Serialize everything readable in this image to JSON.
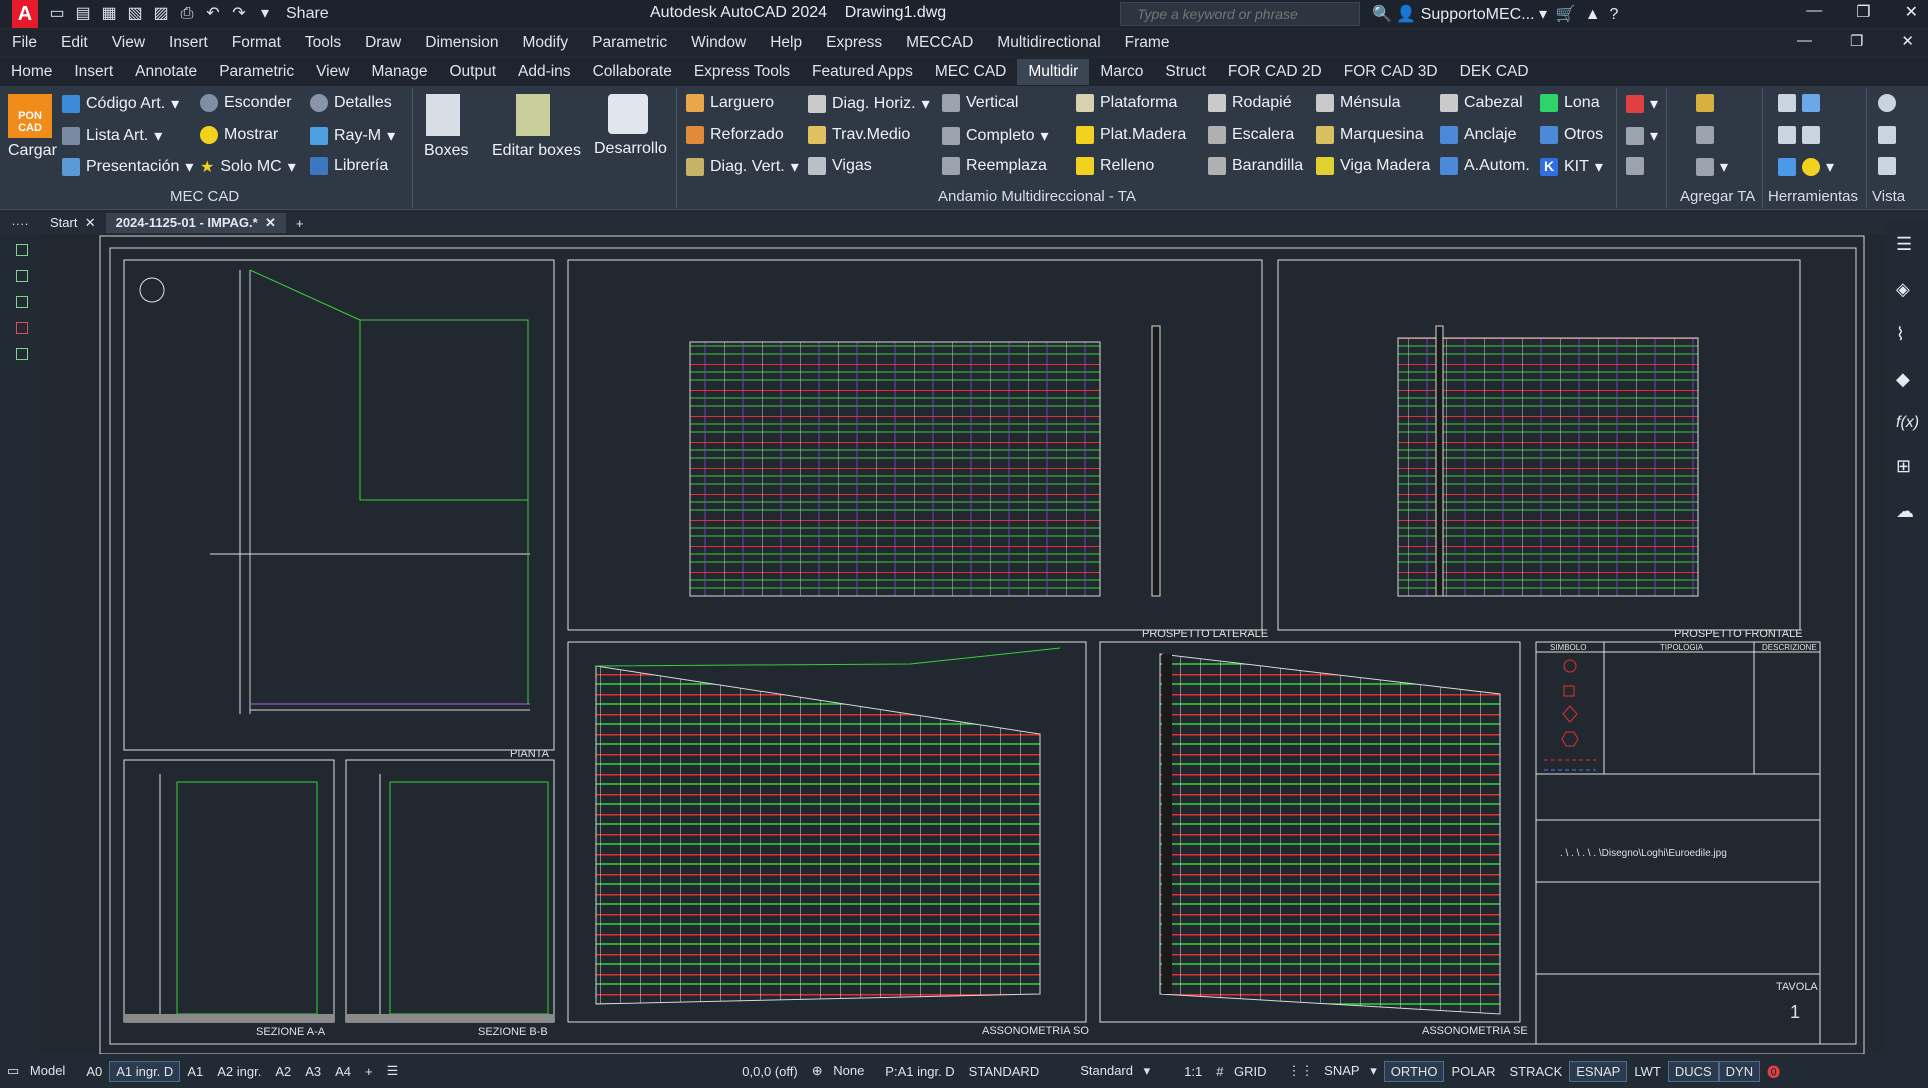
{
  "titlebar": {
    "app_title": "Autodesk AutoCAD 2024",
    "doc_title": "Drawing1.dwg",
    "share": "Share",
    "search_placeholder": "Type a keyword or phrase",
    "user": "SupportoMEC..."
  },
  "menu": [
    "File",
    "Edit",
    "View",
    "Insert",
    "Format",
    "Tools",
    "Draw",
    "Dimension",
    "Modify",
    "Parametric",
    "Window",
    "Help",
    "Express",
    "MECCAD",
    "Multidirectional",
    "Frame"
  ],
  "tabs": [
    "Home",
    "Insert",
    "Annotate",
    "Parametric",
    "View",
    "Manage",
    "Output",
    "Add-ins",
    "Collaborate",
    "Express Tools",
    "Featured Apps",
    "MEC CAD",
    "Multidir",
    "Marco",
    "Struct",
    "FOR CAD 2D",
    "FOR CAD 3D",
    "DEK CAD"
  ],
  "active_tab": "Multidir",
  "ribbon": {
    "mec": {
      "cargar": "Cargar",
      "codigo": "Código Art.",
      "lista": "Lista Art.",
      "presentacion": "Presentación",
      "esconder": "Esconder",
      "mostrar": "Mostrar",
      "solo": "Solo MC",
      "detalles": "Detalles",
      "raym": "Ray-M",
      "libreria": "Librería",
      "group": "MEC CAD",
      "logo": "PON CAD"
    },
    "boxes": {
      "boxes": "Boxes",
      "editar": "Editar boxes",
      "desarrollo": "Desarrollo"
    },
    "multi": {
      "larguero": "Larguero",
      "reforzado": "Reforzado",
      "diagv": "Diag. Vert.",
      "diagh": "Diag. Horiz.",
      "travmedio": "Trav.Medio",
      "vigas": "Vigas",
      "vertical": "Vertical",
      "completo": "Completo",
      "reemplaza": "Reemplaza",
      "plataforma": "Plataforma",
      "platmadera": "Plat.Madera",
      "relleno": "Relleno",
      "rodapie": "Rodapié",
      "escalera": "Escalera",
      "barandilla": "Barandilla",
      "mensula": "Ménsula",
      "marquesina": "Marquesina",
      "vigamadera": "Viga Madera",
      "cabezal": "Cabezal",
      "anclaje": "Anclaje",
      "aautom": "A.Autom.",
      "lona": "Lona",
      "otros": "Otros",
      "kit": "KIT",
      "group": "Andamio Multidireccional - TA"
    },
    "agregar": "Agregar TA",
    "herramientas": "Herramientas",
    "vista": "Vista"
  },
  "doctabs": [
    "Start",
    "2024-1125-01 - IMPAG.*"
  ],
  "drawing": {
    "pianta": "PIANTA",
    "sez_a": "SEZIONE  A-A",
    "sez_b": "SEZIONE  B-B",
    "laterale": "PROSPETTO  LATERALE",
    "frontale": "PROSPETTO  FRONTALE",
    "asso_so": "ASSONOMETRIA  SO",
    "asso_se": "ASSONOMETRIA  SE",
    "legend_head": [
      "SIMBOLO",
      "TIPOLOGIA",
      "DESCRIZIONE"
    ],
    "logo_path": ". \\ . \\ . \\ . \\Disegno\\Loghi\\Euroedile.jpg",
    "tavola": "TAVOLA",
    "tavola_num": "1"
  },
  "statusbar": {
    "model": "Model",
    "layouts": [
      "A0",
      "A1 ingr. D",
      "A1",
      "A2 ingr.",
      "A2",
      "A3",
      "A4"
    ],
    "coords": "0,0,0 (off)",
    "none": "None",
    "p": "P:A1 ingr. D",
    "std1": "STANDARD",
    "std2": "Standard",
    "scale": "1:1",
    "grid": "GRID",
    "snap": "SNAP",
    "ortho": "ORTHO",
    "polar": "POLAR",
    "strack": "STRACK",
    "esnap": "ESNAP",
    "lwt": "LWT",
    "ducs": "DUCS",
    "dyn": "DYN"
  }
}
